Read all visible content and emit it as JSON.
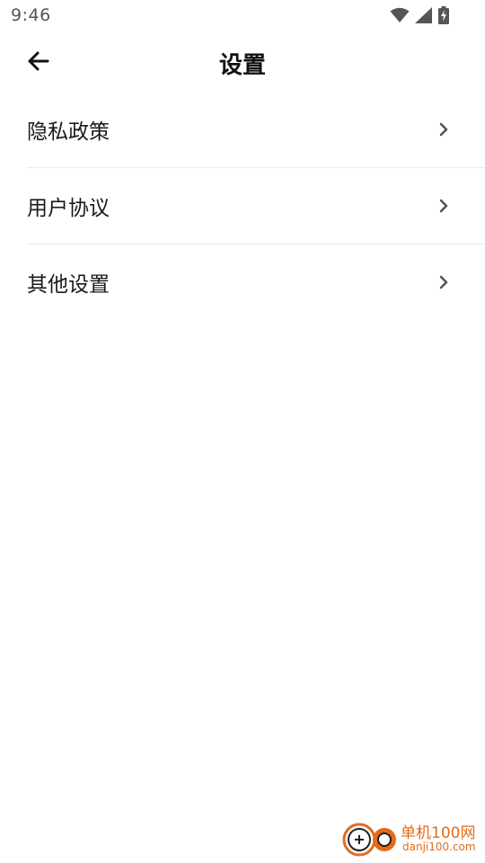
{
  "status_bar": {
    "time": "9:46",
    "icons": [
      "wifi-icon",
      "cellular-signal-icon",
      "battery-charging-icon"
    ]
  },
  "header": {
    "back_icon": "arrow-left-icon",
    "title": "设置"
  },
  "settings": {
    "items": [
      {
        "label": "隐私政策",
        "icon": "chevron-right-icon"
      },
      {
        "label": "用户协议",
        "icon": "chevron-right-icon"
      },
      {
        "label": "其他设置",
        "icon": "chevron-right-icon"
      }
    ]
  },
  "watermark": {
    "name": "单机100网",
    "domain": "danji100.com"
  },
  "colors": {
    "background": "#ffffff",
    "text": "#111111",
    "divider": "#ececec",
    "chevron": "#555555",
    "status": "#555555",
    "watermark": "#e36b1a"
  }
}
